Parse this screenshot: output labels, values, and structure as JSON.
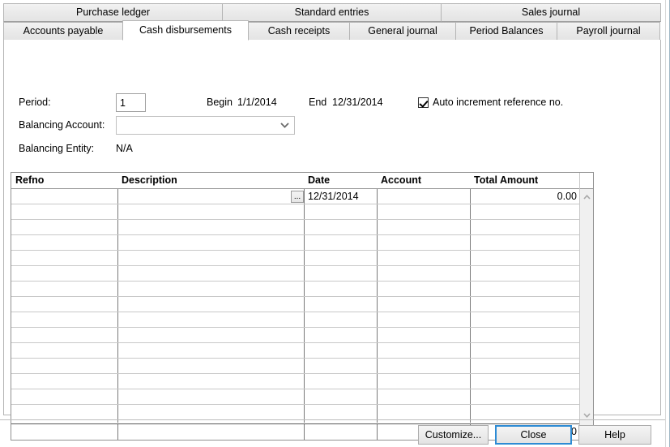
{
  "window": {
    "title": "Cash disbursements"
  },
  "tabs": {
    "top_row": [
      {
        "label": "Purchase ledger",
        "active": false
      },
      {
        "label": "Standard entries",
        "active": false
      },
      {
        "label": "Sales journal",
        "active": false
      }
    ],
    "bottom_row": [
      {
        "label": "Accounts payable",
        "active": false
      },
      {
        "label": "Cash disbursements",
        "active": true
      },
      {
        "label": "Cash receipts",
        "active": false
      },
      {
        "label": "General journal",
        "active": false
      },
      {
        "label": "Period Balances",
        "active": false
      },
      {
        "label": "Payroll journal",
        "active": false
      }
    ]
  },
  "form": {
    "period_label": "Period:",
    "period_value": "1",
    "begin_label": "Begin",
    "begin_value": "1/1/2014",
    "end_label": "End",
    "end_value": "12/31/2014",
    "auto_increment_label": "Auto increment reference no.",
    "auto_increment_checked": true,
    "balancing_account_label": "Balancing Account:",
    "balancing_account_value": "",
    "balancing_account_placeholder": "",
    "balancing_entity_label": "Balancing Entity:",
    "balancing_entity_value": "N/A"
  },
  "grid": {
    "columns": [
      {
        "key": "refno",
        "label": "Refno"
      },
      {
        "key": "description",
        "label": "Description"
      },
      {
        "key": "date",
        "label": "Date"
      },
      {
        "key": "account",
        "label": "Account"
      },
      {
        "key": "total_amount",
        "label": "Total Amount"
      }
    ],
    "rows": [
      {
        "refno": "",
        "description": "",
        "description_button": "...",
        "date": "12/31/2014",
        "account": "",
        "total_amount": "0.00"
      }
    ],
    "empty_row_count": 14,
    "total_row": {
      "refno": "",
      "description": "",
      "date": "",
      "account": "",
      "total_amount": "0.00"
    },
    "scrollbar": {
      "up_arrow": "scroll-up",
      "down_arrow": "scroll-down"
    }
  },
  "footer": {
    "customize_label": "Customize...",
    "close_label": "Close",
    "help_label": "Help",
    "focused_button": "Close"
  },
  "colors": {
    "focus_blue": "#2d8bd4",
    "tab_face": "#eaeaea",
    "border": "#b4b4b4",
    "grid_line": "#c8c8c8",
    "grid_border": "#919191"
  }
}
